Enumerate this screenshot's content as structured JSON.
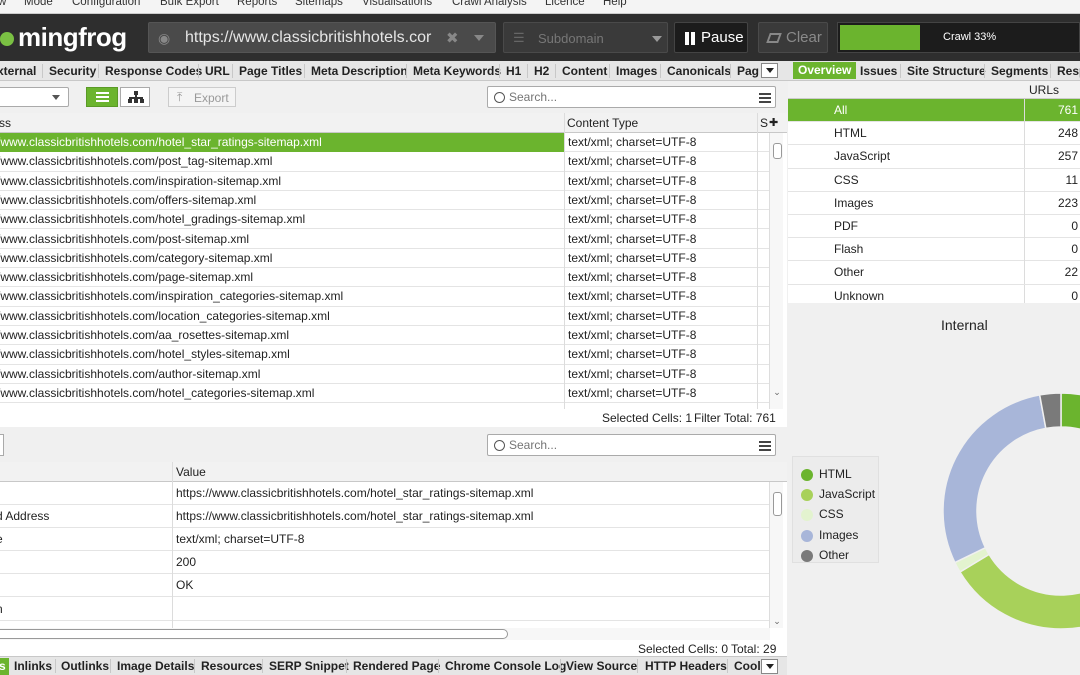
{
  "menu": [
    "w",
    "Mode",
    "Configuration",
    "Bulk Export",
    "Reports",
    "Sitemaps",
    "Visualisations",
    "Crawl Analysis",
    "Licence",
    "Help"
  ],
  "brand": {
    "logo_text": "mingfrog",
    "accent": "#6bb42e"
  },
  "crawl": {
    "url": "https://www.classicbritishhotels.cor",
    "mode": "Subdomain",
    "pause_label": "Pause",
    "clear_label": "Clear",
    "progress_label": "Crawl 33%",
    "progress_fraction": 0.33
  },
  "main_tabs": [
    "xternal",
    "Security",
    "Response Codes",
    "URL",
    "Page Titles",
    "Meta Description",
    "Meta Keywords",
    "H1",
    "H2",
    "Content",
    "Images",
    "Canonicals",
    "Pag"
  ],
  "right_tabs": [
    "Overview",
    "Issues",
    "Site Structure",
    "Segments",
    "Resp"
  ],
  "toolbar": {
    "export_label": "Export",
    "search_placeholder": "Search..."
  },
  "url_grid": {
    "headers": [
      "ss",
      "Content Type",
      "S"
    ],
    "rows": [
      {
        "address": "/www.classicbritishhotels.com/hotel_star_ratings-sitemap.xml",
        "type": "text/xml; charset=UTF-8"
      },
      {
        "address": "/www.classicbritishhotels.com/post_tag-sitemap.xml",
        "type": "text/xml; charset=UTF-8"
      },
      {
        "address": "/www.classicbritishhotels.com/inspiration-sitemap.xml",
        "type": "text/xml; charset=UTF-8"
      },
      {
        "address": "/www.classicbritishhotels.com/offers-sitemap.xml",
        "type": "text/xml; charset=UTF-8"
      },
      {
        "address": "/www.classicbritishhotels.com/hotel_gradings-sitemap.xml",
        "type": "text/xml; charset=UTF-8"
      },
      {
        "address": "/www.classicbritishhotels.com/post-sitemap.xml",
        "type": "text/xml; charset=UTF-8"
      },
      {
        "address": "/www.classicbritishhotels.com/category-sitemap.xml",
        "type": "text/xml; charset=UTF-8"
      },
      {
        "address": "/www.classicbritishhotels.com/page-sitemap.xml",
        "type": "text/xml; charset=UTF-8"
      },
      {
        "address": "/www.classicbritishhotels.com/inspiration_categories-sitemap.xml",
        "type": "text/xml; charset=UTF-8"
      },
      {
        "address": "/www.classicbritishhotels.com/location_categories-sitemap.xml",
        "type": "text/xml; charset=UTF-8"
      },
      {
        "address": "/www.classicbritishhotels.com/aa_rosettes-sitemap.xml",
        "type": "text/xml; charset=UTF-8"
      },
      {
        "address": "/www.classicbritishhotels.com/hotel_styles-sitemap.xml",
        "type": "text/xml; charset=UTF-8"
      },
      {
        "address": "/www.classicbritishhotels.com/author-sitemap.xml",
        "type": "text/xml; charset=UTF-8"
      },
      {
        "address": "/www.classicbritishhotels.com/hotel_categories-sitemap.xml",
        "type": "text/xml; charset=UTF-8"
      }
    ],
    "status": {
      "selected": "Selected Cells:  1",
      "filter_total": "Filter Total:  761"
    }
  },
  "details": {
    "search_placeholder": "Search...",
    "headers": [
      "Value"
    ],
    "rows": [
      {
        "name": "",
        "value": "https://www.classicbritishhotels.com/hotel_star_ratings-sitemap.xml"
      },
      {
        "name": "d Address",
        "value": "https://www.classicbritishhotels.com/hotel_star_ratings-sitemap.xml"
      },
      {
        "name": "e",
        "value": "text/xml; charset=UTF-8"
      },
      {
        "name": "",
        "value": "200"
      },
      {
        "name": "",
        "value": "OK"
      },
      {
        "name": "n",
        "value": ""
      }
    ],
    "status": {
      "selected": "Selected Cells:  0",
      "total": "Total:  29"
    }
  },
  "overview": {
    "header": "URLs",
    "rows": [
      {
        "label": "All",
        "value": "761"
      },
      {
        "label": "HTML",
        "value": "248"
      },
      {
        "label": "JavaScript",
        "value": "257"
      },
      {
        "label": "CSS",
        "value": "11"
      },
      {
        "label": "Images",
        "value": "223"
      },
      {
        "label": "PDF",
        "value": "0"
      },
      {
        "label": "Flash",
        "value": "0"
      },
      {
        "label": "Other",
        "value": "22"
      },
      {
        "label": "Unknown",
        "value": "0"
      }
    ]
  },
  "chart_data": {
    "type": "pie",
    "title": "Internal",
    "categories": [
      "HTML",
      "JavaScript",
      "CSS",
      "Images",
      "Other"
    ],
    "values": [
      248,
      257,
      11,
      223,
      22
    ],
    "colors": [
      "#6bb42e",
      "#a8d15a",
      "#e3f3cf",
      "#a8b6d9",
      "#7a7a7a"
    ],
    "legend_position": "left"
  },
  "bottom_tabs": [
    "s",
    "Inlinks",
    "Outlinks",
    "Image Details",
    "Resources",
    "SERP Snippet",
    "Rendered Page",
    "Chrome Console Log",
    "View Source",
    "HTTP Headers",
    "Cool"
  ]
}
